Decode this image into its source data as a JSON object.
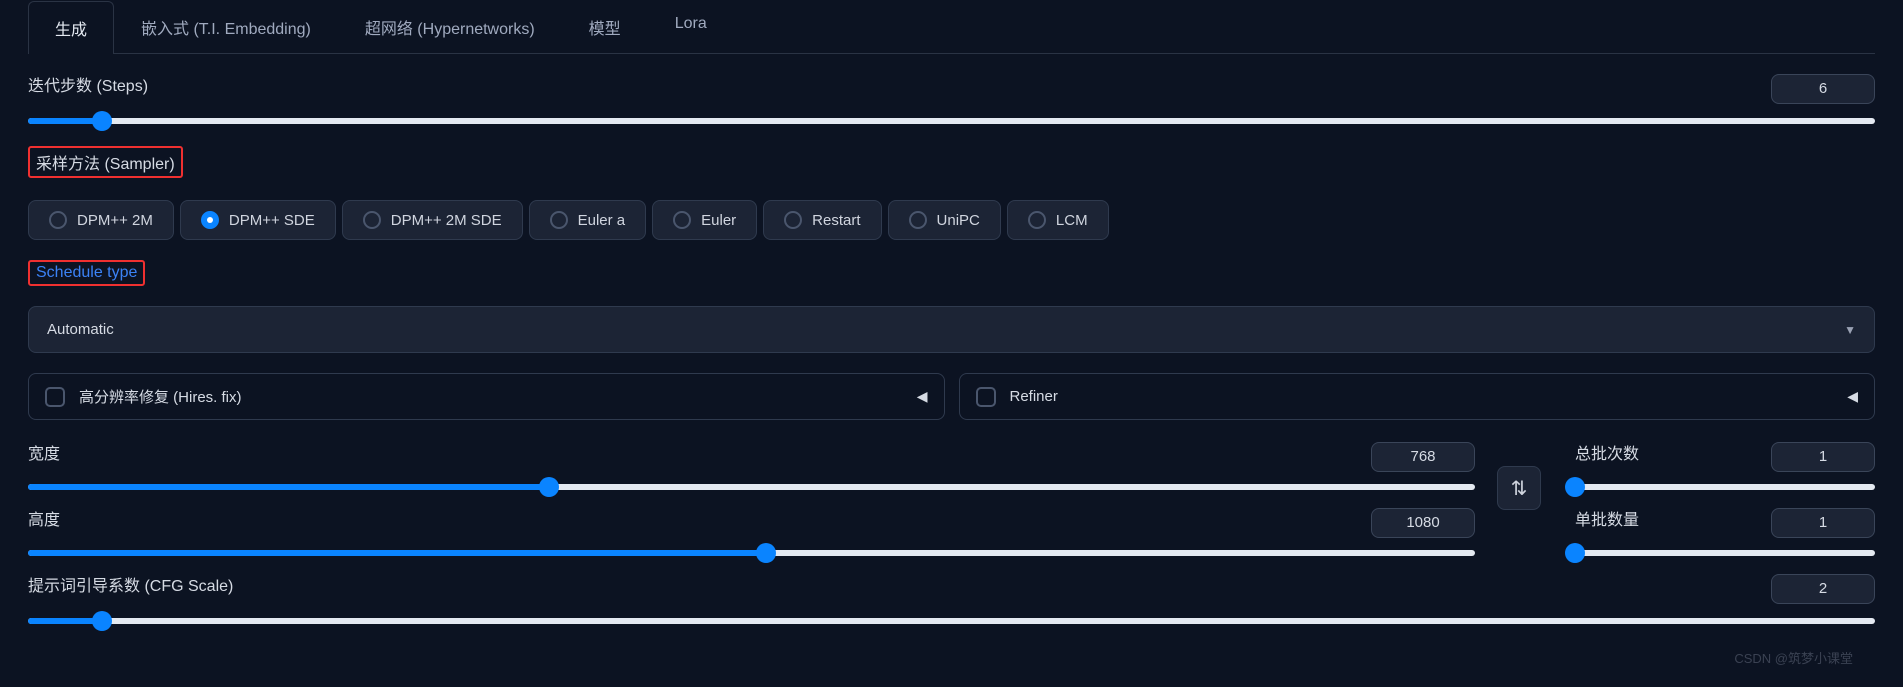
{
  "tabs": {
    "items": [
      {
        "label": "生成",
        "active": true
      },
      {
        "label": "嵌入式 (T.I. Embedding)",
        "active": false
      },
      {
        "label": "超网络 (Hypernetworks)",
        "active": false
      },
      {
        "label": "模型",
        "active": false
      },
      {
        "label": "Lora",
        "active": false
      }
    ]
  },
  "steps": {
    "label": "迭代步数 (Steps)",
    "value": "6",
    "fill_pct": 4
  },
  "sampler": {
    "label": "采样方法 (Sampler)",
    "options": [
      {
        "label": "DPM++ 2M",
        "selected": false
      },
      {
        "label": "DPM++ SDE",
        "selected": true
      },
      {
        "label": "DPM++ 2M SDE",
        "selected": false
      },
      {
        "label": "Euler a",
        "selected": false
      },
      {
        "label": "Euler",
        "selected": false
      },
      {
        "label": "Restart",
        "selected": false
      },
      {
        "label": "UniPC",
        "selected": false
      },
      {
        "label": "LCM",
        "selected": false
      }
    ]
  },
  "schedule": {
    "label": "Schedule type",
    "selected": "Automatic"
  },
  "accordion": {
    "hires": {
      "label": "高分辨率修复 (Hires. fix)"
    },
    "refiner": {
      "label": "Refiner"
    }
  },
  "dims": {
    "width": {
      "label": "宽度",
      "value": "768",
      "fill_pct": 36
    },
    "height": {
      "label": "高度",
      "value": "1080",
      "fill_pct": 51
    }
  },
  "batch": {
    "count": {
      "label": "总批次数",
      "value": "1",
      "fill_pct": 0
    },
    "size": {
      "label": "单批数量",
      "value": "1",
      "fill_pct": 0
    }
  },
  "cfg": {
    "label": "提示词引导系数 (CFG Scale)",
    "value": "2",
    "fill_pct": 4
  },
  "watermark": "CSDN @筑梦小课堂"
}
